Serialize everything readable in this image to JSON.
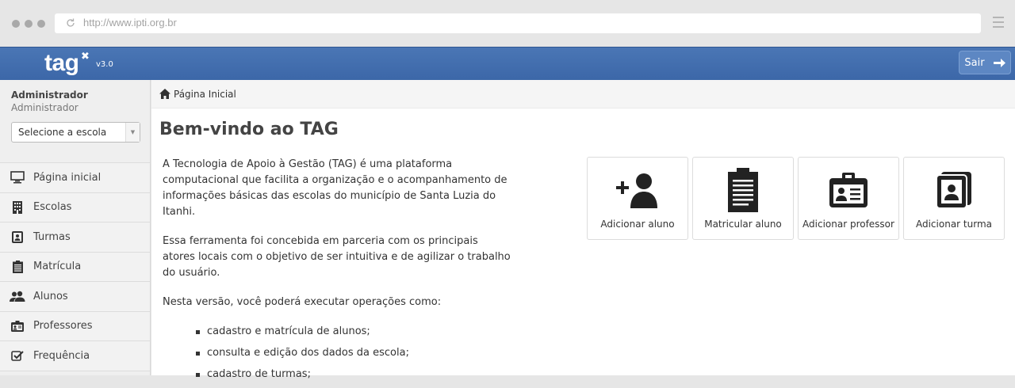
{
  "browser": {
    "url": "http://www.ipti.org.br"
  },
  "navbar": {
    "logo": "tag",
    "version": "v3.0",
    "logout_label": "Sair"
  },
  "sidebar": {
    "user_name": "Administrador",
    "user_role": "Administrador",
    "school_select": "Selecione a escola",
    "items": [
      {
        "label": "Página inicial",
        "icon": "monitor-icon"
      },
      {
        "label": "Escolas",
        "icon": "building-icon"
      },
      {
        "label": "Turmas",
        "icon": "contact-book-icon"
      },
      {
        "label": "Matrícula",
        "icon": "clipboard-icon"
      },
      {
        "label": "Alunos",
        "icon": "users-icon"
      },
      {
        "label": "Professores",
        "icon": "id-card-icon"
      },
      {
        "label": "Frequência",
        "icon": "check-square-icon"
      }
    ]
  },
  "breadcrumb": {
    "label": "Página Inicial"
  },
  "main": {
    "title": "Bem-vindo ao TAG",
    "paragraphs": [
      "A Tecnologia de Apoio à Gestão (TAG) é uma plataforma computacional que facilita a organização e o acompanhamento de informações básicas das escolas do município de Santa Luzia do Itanhi.",
      "Essa ferramenta foi concebida em parceria com os principais atores locais com o objetivo de ser intuitiva e de agilizar o trabalho do usuário.",
      "Nesta versão, você poderá executar operações como:"
    ],
    "bullets": [
      "cadastro e matrícula de alunos;",
      "consulta e edição dos dados da escola;",
      "cadastro de turmas;"
    ]
  },
  "tiles": [
    {
      "label": "Adicionar aluno",
      "icon": "add-user-icon"
    },
    {
      "label": "Matricular aluno",
      "icon": "clipboard-icon"
    },
    {
      "label": "Adicionar professor",
      "icon": "id-badge-icon"
    },
    {
      "label": "Adicionar turma",
      "icon": "contact-book-icon"
    }
  ],
  "colors": {
    "navbar": "#4470b0",
    "sidebar": "#efefef",
    "icon": "#222222"
  }
}
